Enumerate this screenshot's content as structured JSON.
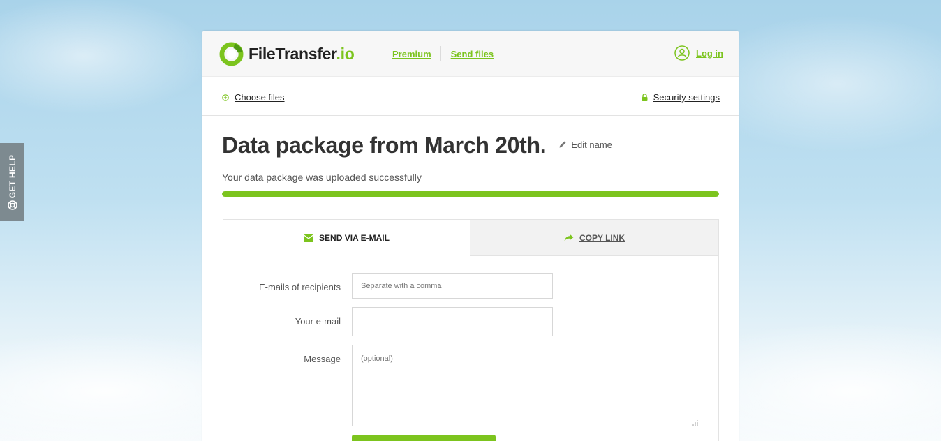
{
  "help_tab": {
    "label": "GET HELP"
  },
  "header": {
    "logo": {
      "name": "FileTransfer",
      "tld": ".io"
    },
    "nav": [
      {
        "label": "Premium"
      },
      {
        "label": "Send files"
      }
    ],
    "login_label": "Log in"
  },
  "toolbar": {
    "choose_files": "Choose files",
    "security_settings": "Security settings"
  },
  "package": {
    "title": "Data package from March 20th.",
    "edit_name": "Edit name",
    "status": "Your data package was uploaded successfully",
    "progress_percent": 100
  },
  "tabs": [
    {
      "label": "SEND VIA E-MAIL",
      "active": true
    },
    {
      "label": "COPY LINK",
      "active": false
    }
  ],
  "form": {
    "recipients": {
      "label": "E-mails of recipients",
      "placeholder": "Separate with a comma",
      "value": ""
    },
    "your_email": {
      "label": "Your e-mail",
      "placeholder": "",
      "value": ""
    },
    "message": {
      "label": "Message",
      "placeholder": "(optional)",
      "value": ""
    },
    "submit_label": ""
  },
  "colors": {
    "accent": "#7cc41e",
    "help_tab": "#7d8a90",
    "title_text": "#333333"
  }
}
